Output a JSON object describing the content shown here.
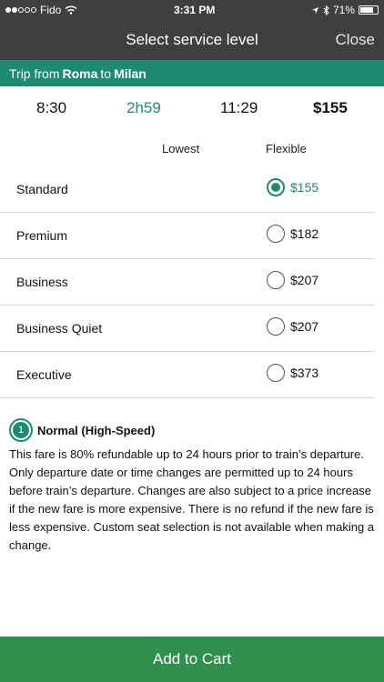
{
  "status_bar": {
    "carrier": "Fido",
    "time": "3:31 PM",
    "battery": "71%"
  },
  "nav": {
    "title": "Select service level",
    "close_label": "Close"
  },
  "trip": {
    "prefix": "Trip from",
    "origin": "Roma",
    "connector": "to",
    "destination": "Milan"
  },
  "summary": {
    "departure": "8:30",
    "duration": "2h59",
    "arrival": "11:29",
    "price": "$155"
  },
  "columns": {
    "lowest": "Lowest",
    "flexible": "Flexible"
  },
  "fares": [
    {
      "name": "Standard",
      "price": "$155",
      "selected": true
    },
    {
      "name": "Premium",
      "price": "$182",
      "selected": false
    },
    {
      "name": "Business",
      "price": "$207",
      "selected": false
    },
    {
      "name": "Business Quiet",
      "price": "$207",
      "selected": false
    },
    {
      "name": "Executive",
      "price": "$373",
      "selected": false
    }
  ],
  "info": {
    "badge": "1",
    "title": "Normal (High-Speed)",
    "text": "This fare is 80% refundable up to 24 hours prior to train’s departure. Only departure date or time changes are permitted up to 24 hours before train’s departure. Changes are also subject to a price increase if the new fare is more expensive. There is no refund if the new fare is less expensive. Custom seat selection is not available when making a change."
  },
  "cart": {
    "label": "Add to Cart"
  },
  "colors": {
    "accent": "#1f8a72",
    "cart_button": "#2f8f4d",
    "header": "#3f3f3f"
  }
}
